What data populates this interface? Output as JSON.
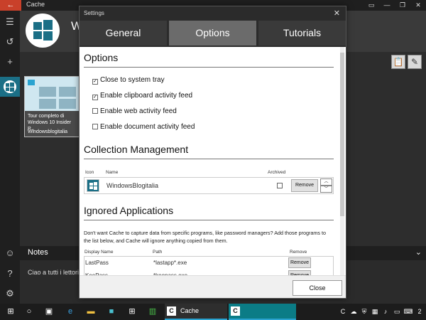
{
  "app": {
    "window_title": "Cache",
    "header_title": "W",
    "notes_label": "Notes",
    "notes_text": "Ciao a tutti i lettori d",
    "card": {
      "title": "Tour completo di Windows 10 Insider P...",
      "source": "Windowsblogitalia"
    },
    "icons": {
      "back": "back-arrow-icon",
      "menu": "hamburger-icon",
      "history": "history-icon",
      "add": "plus-icon",
      "smiley": "smiley-icon",
      "help": "help-icon",
      "settings": "gear-icon"
    }
  },
  "dialog": {
    "title": "Settings",
    "tabs": [
      {
        "label": "General",
        "selected": false
      },
      {
        "label": "Options",
        "selected": true
      },
      {
        "label": "Tutorials",
        "selected": false
      }
    ],
    "options_heading": "Options",
    "checkboxes": [
      {
        "label": "Close to system tray",
        "checked": true
      },
      {
        "label": "Enable clipboard activity feed",
        "checked": true
      },
      {
        "label": "Enable web activity feed",
        "checked": false
      },
      {
        "label": "Enable document activity feed",
        "checked": false
      }
    ],
    "collection_heading": "Collection Management",
    "collection_columns": {
      "icon": "Icon",
      "name": "Name",
      "archived": "Archived"
    },
    "collections": [
      {
        "name": "WindowsBlogitalia",
        "archived": false,
        "remove_label": "Remove"
      }
    ],
    "ignored_heading": "Ignored Applications",
    "ignored_description": "Don't want Cache to capture data from specific programs, like password managers? Add those programs to the list below, and Cache will ignore anything copied from them.",
    "ignored_columns": {
      "display_name": "Display Name",
      "path": "Path",
      "remove": "Remove"
    },
    "ignored_apps": [
      {
        "name": "LastPass",
        "path": "*lastapp*.exe",
        "remove_label": "Remove"
      },
      {
        "name": "KeePass",
        "path": "*keepass.exe",
        "remove_label": "Remove"
      }
    ],
    "close_label": "Close"
  },
  "taskbar": {
    "active_app_label": "Cache",
    "time_hint": "2"
  },
  "colors": {
    "accent": "#1b6f86",
    "back_button": "#c9402a",
    "taskbar_active": "#0b7c86"
  }
}
